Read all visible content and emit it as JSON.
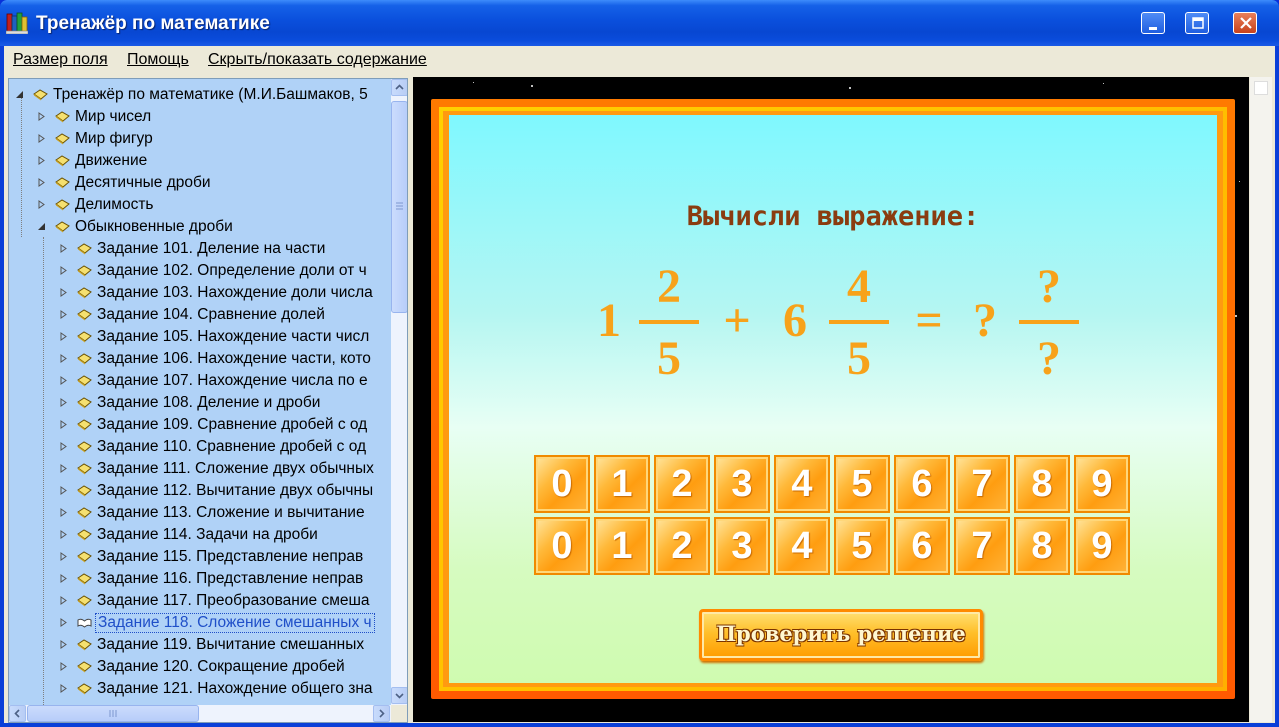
{
  "window": {
    "title": "Тренажёр по математике",
    "icon": "books-icon"
  },
  "menu": {
    "items": [
      "Размер поля",
      "Помощь",
      "Скрыть/показать содержание"
    ]
  },
  "tree": {
    "root": "Тренажёр по математике (М.И.Башмаков, 5",
    "sections": [
      "Мир чисел",
      "Мир фигур",
      "Движение",
      "Десятичные дроби",
      "Делимость",
      "Обыкновенные дроби"
    ],
    "tasks": [
      "Задание 101. Деление на части",
      "Задание 102. Определение доли от ч",
      "Задание 103. Нахождение доли числа",
      "Задание 104. Сравнение долей",
      "Задание 105. Нахождение части числ",
      "Задание 106. Нахождение части, кото",
      "Задание 107. Нахождение числа по е",
      "Задание 108. Деление и дроби",
      "Задание 109. Сравнение дробей с од",
      "Задание 110. Сравнение дробей с од",
      "Задание 111. Сложение двух обычных",
      "Задание 112. Вычитание двух обычны",
      "Задание 113. Сложение и вычитание",
      "Задание 114. Задачи на дроби",
      "Задание 115. Представление неправ",
      "Задание 116. Представление неправ",
      "Задание 117. Преобразование смеша",
      "Задание 118. Сложение смешанных ч",
      "Задание 119. Вычитание смешанных",
      "Задание 120. Сокращение дробей",
      "Задание 121. Нахождение общего зна"
    ],
    "selected_index": 17
  },
  "exercise": {
    "title": "Вычисли выражение:",
    "expression": {
      "whole1": "1",
      "num1": "2",
      "den1": "5",
      "op": "+",
      "whole2": "6",
      "num2": "4",
      "den2": "5",
      "eq": "=",
      "ans_whole": "?",
      "ans_num": "?",
      "ans_den": "?"
    },
    "digits_row1": [
      "0",
      "1",
      "2",
      "3",
      "4",
      "5",
      "6",
      "7",
      "8",
      "9"
    ],
    "digits_row2": [
      "0",
      "1",
      "2",
      "3",
      "4",
      "5",
      "6",
      "7",
      "8",
      "9"
    ],
    "check_label": "Проверить решение"
  },
  "colors": {
    "accent_orange": "#f7a21a",
    "title_brown": "#8a3c10",
    "tree_bg": "#b0d2f7",
    "titlebar_blue": "#0a4fdc"
  }
}
